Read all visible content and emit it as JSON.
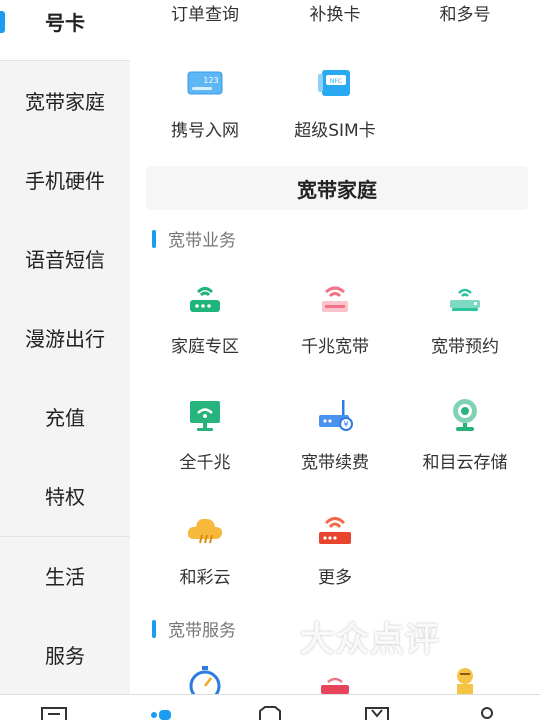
{
  "sidebar": {
    "items": [
      {
        "label": "号卡",
        "active": true
      },
      {
        "label": "宽带家庭"
      },
      {
        "label": "手机硬件"
      },
      {
        "label": "语音短信"
      },
      {
        "label": "漫游出行"
      },
      {
        "label": "充值"
      },
      {
        "label": "特权"
      },
      {
        "label": "生活"
      },
      {
        "label": "服务"
      }
    ]
  },
  "main": {
    "top_links": [
      "订单查询",
      "补换卡",
      "和多号"
    ],
    "card_items": [
      {
        "label": "携号入网",
        "icon": "sim-123-icon"
      },
      {
        "label": "超级SIM卡",
        "icon": "nfc-sim-icon"
      }
    ],
    "section_title": "宽带家庭",
    "broadband_business": {
      "heading": "宽带业务",
      "items": [
        {
          "label": "家庭专区",
          "icon": "home-router-icon"
        },
        {
          "label": "千兆宽带",
          "icon": "gigabit-router-icon"
        },
        {
          "label": "宽带预约",
          "icon": "router-booking-icon"
        },
        {
          "label": "全千兆",
          "icon": "full-gigabit-monitor-icon"
        },
        {
          "label": "宽带续费",
          "icon": "broadband-renew-icon"
        },
        {
          "label": "和目云存储",
          "icon": "webcam-cloud-icon"
        },
        {
          "label": "和彩云",
          "icon": "cloud-icon"
        },
        {
          "label": "更多",
          "icon": "more-router-icon"
        }
      ]
    },
    "broadband_service": {
      "heading": "宽带服务"
    }
  },
  "watermark": "大众点评",
  "colors": {
    "accent": "#1a9cf0",
    "sidebar_bg": "#f4f4f4"
  }
}
